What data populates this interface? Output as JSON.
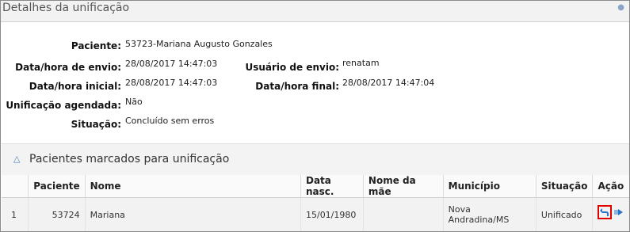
{
  "panel": {
    "title": "Detalhes da unificação"
  },
  "details": {
    "paciente_label": "Paciente:",
    "paciente_value": "53723-Mariana Augusto Gonzales",
    "data_envio_label": "Data/hora de envio:",
    "data_envio_value": "28/08/2017 14:47:03",
    "usuario_envio_label": "Usuário de envio:",
    "usuario_envio_value": "renatam",
    "data_inicial_label": "Data/hora inicial:",
    "data_inicial_value": "28/08/2017 14:47:03",
    "data_final_label": "Data/hora final:",
    "data_final_value": "28/08/2017 14:47:04",
    "agendada_label": "Unificação agendada:",
    "agendada_value": "Não",
    "situacao_label": "Situação:",
    "situacao_value": "Concluído sem erros"
  },
  "section": {
    "title": "Pacientes marcados para unificação"
  },
  "table": {
    "headers": {
      "paciente": "Paciente",
      "nome": "Nome",
      "data_nasc": "Data nasc.",
      "nome_mae": "Nome da mãe",
      "municipio": "Município",
      "situacao": "Situação",
      "acao": "Ação"
    },
    "rows": [
      {
        "index": "1",
        "paciente": "53724",
        "nome": "Mariana",
        "data_nasc": "15/01/1980",
        "nome_mae": "",
        "municipio": "Nova Andradina/MS",
        "situacao": "Unificado"
      }
    ]
  },
  "icons": {
    "undo": "undo-arrow-icon",
    "move": "move-right-icon",
    "collapse": "triangle-up-icon"
  },
  "colors": {
    "highlight": "#e00000",
    "icon_blue": "#2a73c8"
  }
}
